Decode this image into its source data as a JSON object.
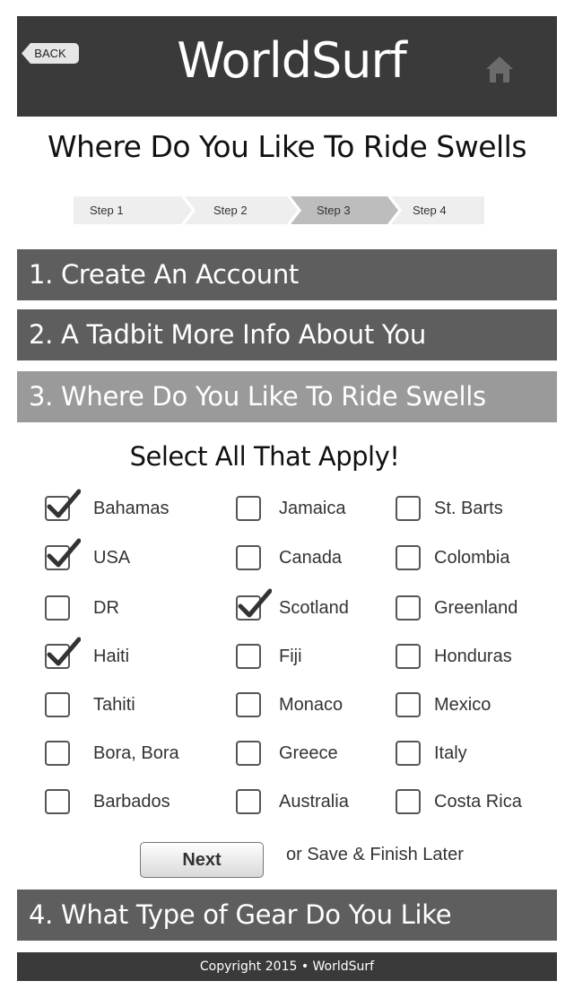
{
  "header": {
    "back_label": "BACK",
    "logo": "WorldSurf",
    "home_icon": "home-icon"
  },
  "page_title": "Where Do You Like To Ride Swells",
  "stepper": {
    "steps": [
      "Step 1",
      "Step 2",
      "Step 3",
      "Step 4"
    ],
    "active_step": "Step 3"
  },
  "sections": [
    "1. Create An Account",
    "2. A Tadbit More Info About You",
    "3. Where Do You Like To Ride Swells",
    "4. What Type of Gear Do You Like"
  ],
  "select_heading": "Select All That Apply!",
  "countries": [
    {
      "label": "Bahamas",
      "checked": true
    },
    {
      "label": "USA",
      "checked": true
    },
    {
      "label": "DR",
      "checked": false
    },
    {
      "label": "Haiti",
      "checked": true
    },
    {
      "label": "Tahiti",
      "checked": false
    },
    {
      "label": "Bora, Bora",
      "checked": false
    },
    {
      "label": "Barbados",
      "checked": false
    },
    {
      "label": "Jamaica",
      "checked": false
    },
    {
      "label": "Canada",
      "checked": false
    },
    {
      "label": "Scotland",
      "checked": true
    },
    {
      "label": "Fiji",
      "checked": false
    },
    {
      "label": "Monaco",
      "checked": false
    },
    {
      "label": "Greece",
      "checked": false
    },
    {
      "label": "Australia",
      "checked": false
    },
    {
      "label": "St. Barts",
      "checked": false
    },
    {
      "label": "Colombia",
      "checked": false
    },
    {
      "label": "Greenland",
      "checked": false
    },
    {
      "label": "Honduras",
      "checked": false
    },
    {
      "label": "Mexico",
      "checked": false
    },
    {
      "label": "Italy",
      "checked": false
    },
    {
      "label": "Costa Rica",
      "checked": false
    }
  ],
  "next_label": "Next",
  "save_later": "or Save & Finish Later",
  "footer": "Copyright 2015 • WorldSurf",
  "colors": {
    "header_bg": "#3a3a3a",
    "section_dark": "#5e5e5e",
    "section_active": "#9a9a9a",
    "step_bg": "#eeeeee",
    "step_active_bg": "#bdbdbd"
  }
}
